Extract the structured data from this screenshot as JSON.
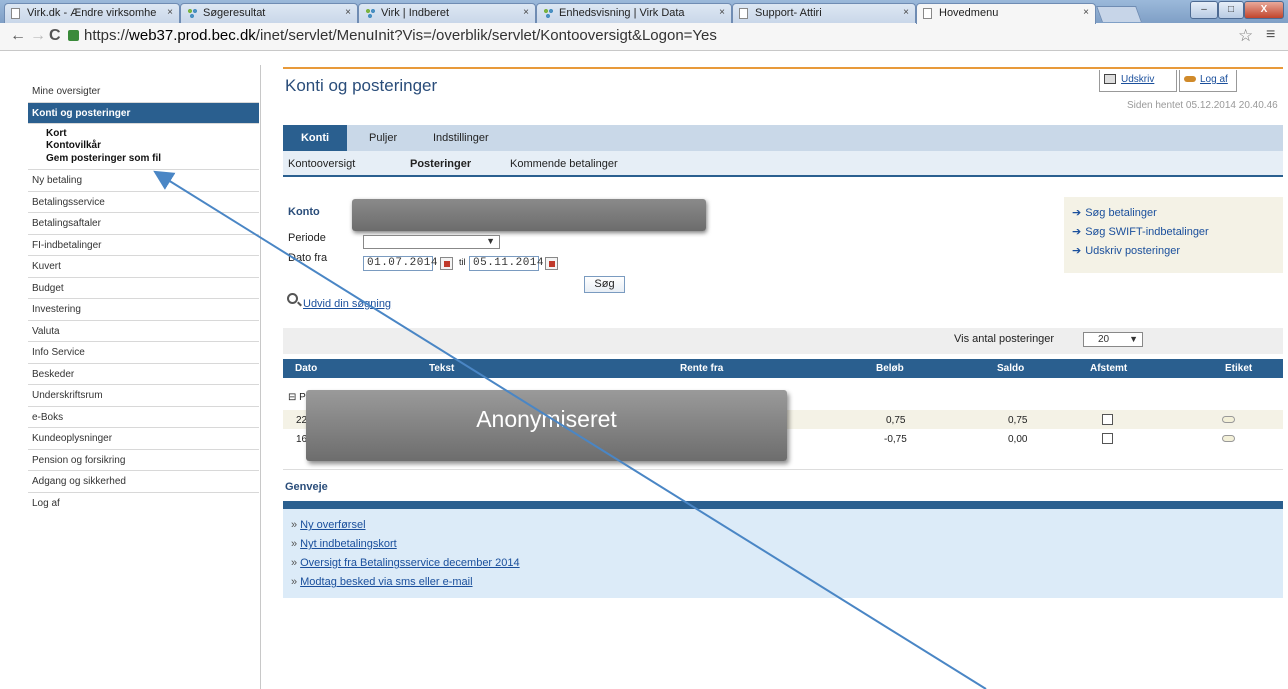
{
  "browser": {
    "tabs": [
      {
        "label": "Virk.dk - Ændre virksomhe",
        "icon": "page-icon"
      },
      {
        "label": "Søgeresultat",
        "icon": "virk-dots-icon"
      },
      {
        "label": "Virk | Indberet",
        "icon": "virk-dots-icon"
      },
      {
        "label": "Enhedsvisning | Virk Data",
        "icon": "virk-dots-icon"
      },
      {
        "label": "Support- Attiri",
        "icon": "page-icon"
      },
      {
        "label": "Hovedmenu",
        "icon": "page-icon"
      }
    ],
    "tab_close": "×",
    "window": {
      "minimize": "–",
      "maximize": "□",
      "close": "X"
    },
    "url_prefix": "https://",
    "url_host": "web37.prod.bec.dk",
    "url_path": "/inet/servlet/MenuInit?Vis=/overblik/servlet/Kontooversigt&Logon=Yes",
    "back": "←",
    "forward": "→",
    "reload": "C",
    "star": "☆",
    "menu": "≡"
  },
  "sidebar": {
    "items_before": [
      "Mine oversigter"
    ],
    "active": "Konti og posteringer",
    "sub": [
      "Kort",
      "Kontovilkår",
      "Gem posteringer som fil"
    ],
    "items_after": [
      "Ny betaling",
      "Betalingsservice",
      "Betalingsaftaler",
      "FI-indbetalinger",
      "Kuvert",
      "Budget",
      "Investering",
      "Valuta",
      "Info Service",
      "Beskeder",
      "Underskriftsrum",
      "e-Boks",
      "Kundeoplysninger",
      "Pension og forsikring",
      "Adgang og sikkerhed",
      "Log af"
    ]
  },
  "main": {
    "title": "Konti og posteringer",
    "print_label": "Udskriv",
    "logout_label": "Log af",
    "fetched": "Siden hentet 05.12.2014 20.40.46",
    "tabs": [
      "Konti",
      "Puljer",
      "Indstillinger"
    ],
    "subtabs": [
      "Kontooversigt",
      "Posteringer",
      "Kommende betalinger"
    ],
    "form": {
      "konto_label": "Konto",
      "periode_label": "Periode",
      "periode_arrow": "▼",
      "dato_fra_label": "Dato fra",
      "date_from": "01.07.2014",
      "til_label": "til",
      "date_to": "05.11.2014",
      "search_button": "Søg",
      "expand_link": "Udvid din søgning"
    },
    "quick_links": [
      "Søg betalinger",
      "Søg SWIFT-indbetalinger",
      "Udskriv posteringer"
    ],
    "quick_arrow": "➔",
    "show_count_label": "Vis antal posteringer",
    "show_count_value": "20",
    "show_count_arrow": "▼",
    "table": {
      "headers": [
        "Dato",
        "Tekst",
        "Rente fra",
        "Beløb",
        "Saldo",
        "Afstemt",
        "Etiket"
      ],
      "group_label": "⊟ P",
      "rows": [
        {
          "date": "22",
          "amount": "0,75",
          "balance": "0,75"
        },
        {
          "date": "16",
          "amount": "-0,75",
          "balance": "0,00"
        }
      ]
    },
    "anon_label": "Anonymiseret",
    "shortcuts_title": "Genveje",
    "shortcut_chevron": "»",
    "shortcuts": [
      "Ny overførsel",
      "Nyt indbetalingskort",
      "Oversigt fra Betalingsservice december 2014",
      "Modtag besked via sms eller e-mail"
    ]
  },
  "colors": {
    "primary": "#2a5f8f",
    "accent": "#e89a3a",
    "link": "#1a4f9c",
    "arrow": "#4a86c5"
  }
}
